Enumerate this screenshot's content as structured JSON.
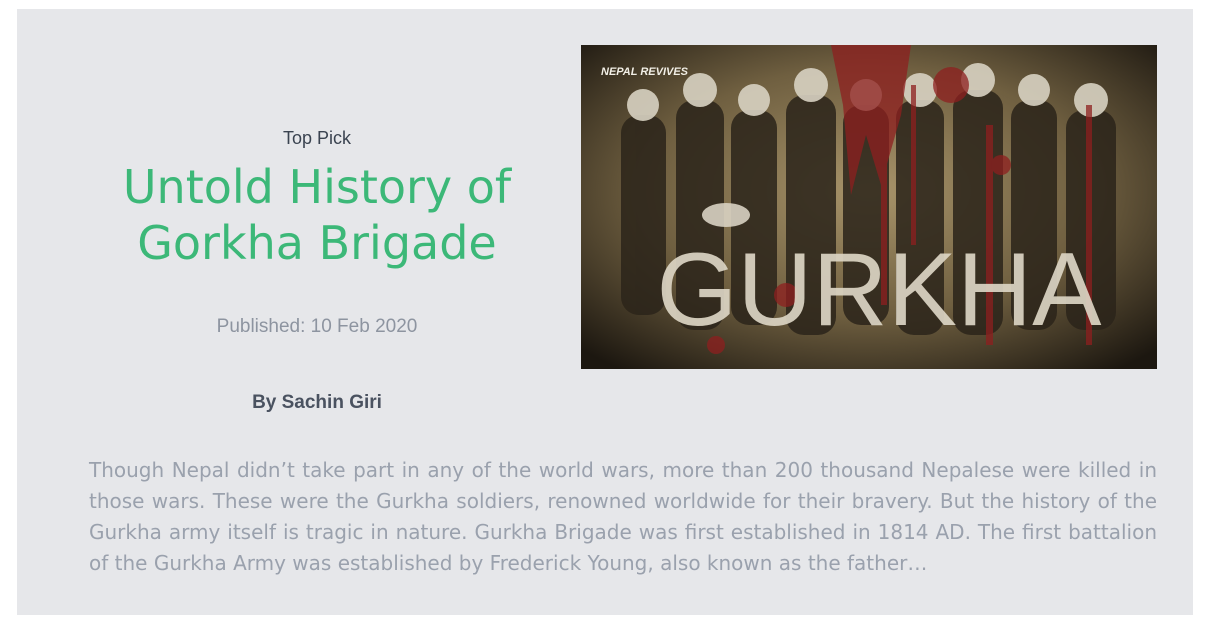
{
  "article": {
    "kicker": "Top Pick",
    "title": "Untold History of Gorkha Brigade",
    "published": "Published: 10 Feb 2020",
    "author": "By Sachin Giri",
    "excerpt": "Though Nepal didn’t take part in any of the world wars, more than 200 thousand Nepalese were killed in those wars. These were the Gurkha soldiers, renowned worldwide for their bravery. But the history of the Gurkha army itself is tragic in nature. Gurkha Brigade was first established in 1814 AD. The first battalion of the Gurkha Army was established by Frederick Young, also known as the father…",
    "image": {
      "overlay_word": "GURKHA",
      "watermark": "NEPAL REVIVES"
    }
  },
  "colors": {
    "card_background": "#e6e7ea",
    "title_green": "#3cb878",
    "muted_text": "#9aa1ad"
  }
}
